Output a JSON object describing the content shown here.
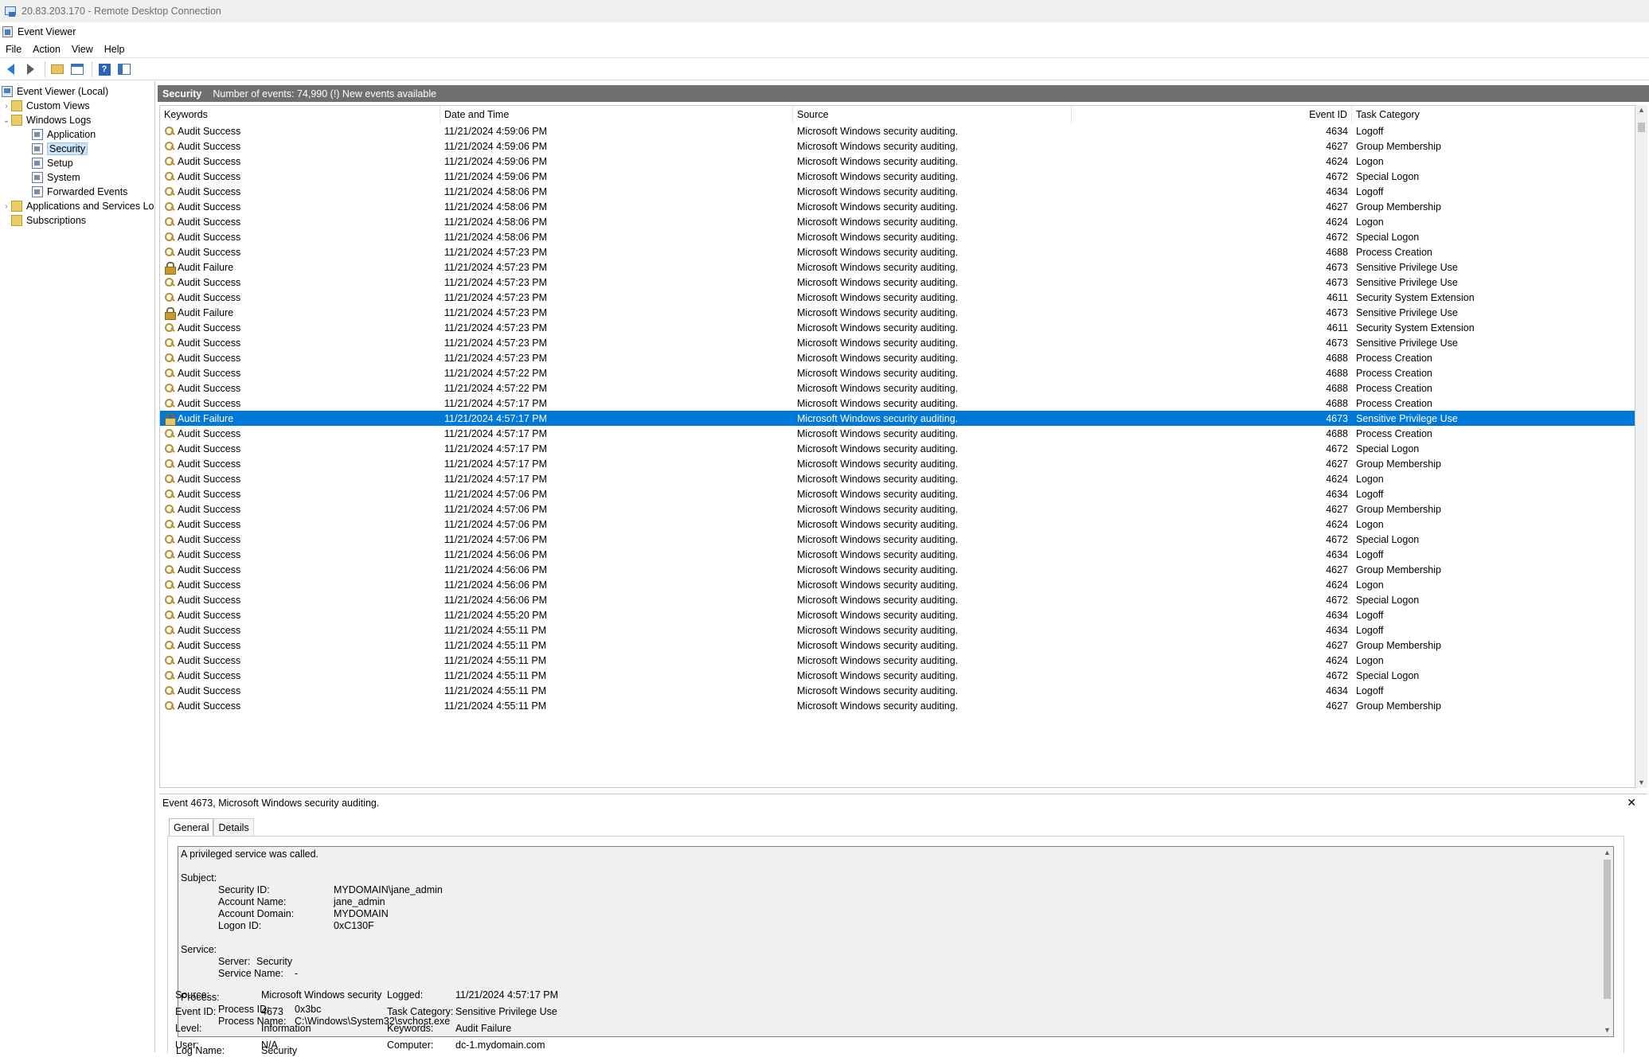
{
  "rdp": {
    "title": "20.83.203.170 - Remote Desktop Connection"
  },
  "app": {
    "title": "Event Viewer"
  },
  "menu": [
    "File",
    "Action",
    "View",
    "Help"
  ],
  "nav": {
    "items": [
      {
        "label": "Event Viewer (Local)",
        "icon": "computer-icon"
      },
      {
        "label": "Custom Views",
        "icon": "folder-icon"
      },
      {
        "label": "Windows Logs",
        "icon": "folder-icon"
      },
      {
        "label": "Application",
        "icon": "log-icon"
      },
      {
        "label": "Security",
        "icon": "log-icon"
      },
      {
        "label": "Setup",
        "icon": "log-icon"
      },
      {
        "label": "System",
        "icon": "log-icon"
      },
      {
        "label": "Forwarded Events",
        "icon": "log-icon"
      },
      {
        "label": "Applications and Services Lo",
        "icon": "folder-icon"
      },
      {
        "label": "Subscriptions",
        "icon": "folder-icon"
      }
    ]
  },
  "log_header": {
    "title": "Security",
    "info": "Number of events: 74,990 (!) New events available"
  },
  "table": {
    "columns": [
      "Keywords",
      "Date and Time",
      "Source",
      "Event ID",
      "Task Category"
    ],
    "rows": [
      [
        "Audit Success",
        "11/21/2024 4:59:06 PM",
        "Microsoft Windows security auditing.",
        "4634",
        "Logoff"
      ],
      [
        "Audit Success",
        "11/21/2024 4:59:06 PM",
        "Microsoft Windows security auditing.",
        "4627",
        "Group Membership"
      ],
      [
        "Audit Success",
        "11/21/2024 4:59:06 PM",
        "Microsoft Windows security auditing.",
        "4624",
        "Logon"
      ],
      [
        "Audit Success",
        "11/21/2024 4:59:06 PM",
        "Microsoft Windows security auditing.",
        "4672",
        "Special Logon"
      ],
      [
        "Audit Success",
        "11/21/2024 4:58:06 PM",
        "Microsoft Windows security auditing.",
        "4634",
        "Logoff"
      ],
      [
        "Audit Success",
        "11/21/2024 4:58:06 PM",
        "Microsoft Windows security auditing.",
        "4627",
        "Group Membership"
      ],
      [
        "Audit Success",
        "11/21/2024 4:58:06 PM",
        "Microsoft Windows security auditing.",
        "4624",
        "Logon"
      ],
      [
        "Audit Success",
        "11/21/2024 4:58:06 PM",
        "Microsoft Windows security auditing.",
        "4672",
        "Special Logon"
      ],
      [
        "Audit Success",
        "11/21/2024 4:57:23 PM",
        "Microsoft Windows security auditing.",
        "4688",
        "Process Creation"
      ],
      [
        "Audit Failure",
        "11/21/2024 4:57:23 PM",
        "Microsoft Windows security auditing.",
        "4673",
        "Sensitive Privilege Use"
      ],
      [
        "Audit Success",
        "11/21/2024 4:57:23 PM",
        "Microsoft Windows security auditing.",
        "4673",
        "Sensitive Privilege Use"
      ],
      [
        "Audit Success",
        "11/21/2024 4:57:23 PM",
        "Microsoft Windows security auditing.",
        "4611",
        "Security System Extension"
      ],
      [
        "Audit Failure",
        "11/21/2024 4:57:23 PM",
        "Microsoft Windows security auditing.",
        "4673",
        "Sensitive Privilege Use"
      ],
      [
        "Audit Success",
        "11/21/2024 4:57:23 PM",
        "Microsoft Windows security auditing.",
        "4611",
        "Security System Extension"
      ],
      [
        "Audit Success",
        "11/21/2024 4:57:23 PM",
        "Microsoft Windows security auditing.",
        "4673",
        "Sensitive Privilege Use"
      ],
      [
        "Audit Success",
        "11/21/2024 4:57:23 PM",
        "Microsoft Windows security auditing.",
        "4688",
        "Process Creation"
      ],
      [
        "Audit Success",
        "11/21/2024 4:57:22 PM",
        "Microsoft Windows security auditing.",
        "4688",
        "Process Creation"
      ],
      [
        "Audit Success",
        "11/21/2024 4:57:22 PM",
        "Microsoft Windows security auditing.",
        "4688",
        "Process Creation"
      ],
      [
        "Audit Success",
        "11/21/2024 4:57:17 PM",
        "Microsoft Windows security auditing.",
        "4688",
        "Process Creation"
      ],
      [
        "Audit Failure",
        "11/21/2024 4:57:17 PM",
        "Microsoft Windows security auditing.",
        "4673",
        "Sensitive Privilege Use"
      ],
      [
        "Audit Success",
        "11/21/2024 4:57:17 PM",
        "Microsoft Windows security auditing.",
        "4688",
        "Process Creation"
      ],
      [
        "Audit Success",
        "11/21/2024 4:57:17 PM",
        "Microsoft Windows security auditing.",
        "4672",
        "Special Logon"
      ],
      [
        "Audit Success",
        "11/21/2024 4:57:17 PM",
        "Microsoft Windows security auditing.",
        "4627",
        "Group Membership"
      ],
      [
        "Audit Success",
        "11/21/2024 4:57:17 PM",
        "Microsoft Windows security auditing.",
        "4624",
        "Logon"
      ],
      [
        "Audit Success",
        "11/21/2024 4:57:06 PM",
        "Microsoft Windows security auditing.",
        "4634",
        "Logoff"
      ],
      [
        "Audit Success",
        "11/21/2024 4:57:06 PM",
        "Microsoft Windows security auditing.",
        "4627",
        "Group Membership"
      ],
      [
        "Audit Success",
        "11/21/2024 4:57:06 PM",
        "Microsoft Windows security auditing.",
        "4624",
        "Logon"
      ],
      [
        "Audit Success",
        "11/21/2024 4:57:06 PM",
        "Microsoft Windows security auditing.",
        "4672",
        "Special Logon"
      ],
      [
        "Audit Success",
        "11/21/2024 4:56:06 PM",
        "Microsoft Windows security auditing.",
        "4634",
        "Logoff"
      ],
      [
        "Audit Success",
        "11/21/2024 4:56:06 PM",
        "Microsoft Windows security auditing.",
        "4627",
        "Group Membership"
      ],
      [
        "Audit Success",
        "11/21/2024 4:56:06 PM",
        "Microsoft Windows security auditing.",
        "4624",
        "Logon"
      ],
      [
        "Audit Success",
        "11/21/2024 4:56:06 PM",
        "Microsoft Windows security auditing.",
        "4672",
        "Special Logon"
      ],
      [
        "Audit Success",
        "11/21/2024 4:55:20 PM",
        "Microsoft Windows security auditing.",
        "4634",
        "Logoff"
      ],
      [
        "Audit Success",
        "11/21/2024 4:55:11 PM",
        "Microsoft Windows security auditing.",
        "4634",
        "Logoff"
      ],
      [
        "Audit Success",
        "11/21/2024 4:55:11 PM",
        "Microsoft Windows security auditing.",
        "4627",
        "Group Membership"
      ],
      [
        "Audit Success",
        "11/21/2024 4:55:11 PM",
        "Microsoft Windows security auditing.",
        "4624",
        "Logon"
      ],
      [
        "Audit Success",
        "11/21/2024 4:55:11 PM",
        "Microsoft Windows security auditing.",
        "4672",
        "Special Logon"
      ],
      [
        "Audit Success",
        "11/21/2024 4:55:11 PM",
        "Microsoft Windows security auditing.",
        "4634",
        "Logoff"
      ],
      [
        "Audit Success",
        "11/21/2024 4:55:11 PM",
        "Microsoft Windows security auditing.",
        "4627",
        "Group Membership"
      ]
    ]
  },
  "detail": {
    "title": "Event 4673, Microsoft Windows security auditing.",
    "tabs": [
      "General",
      "Details"
    ],
    "description": {
      "line1": "A privileged service was called.",
      "subject_label": "Subject:",
      "security_id_label": "Security ID:",
      "security_id": "MYDOMAIN\\jane_admin",
      "account_name_label": "Account Name:",
      "account_name": "jane_admin",
      "account_domain_label": "Account Domain:",
      "account_domain": "MYDOMAIN",
      "logon_id_label": "Logon ID:",
      "logon_id": "0xC130F",
      "service_label": "Service:",
      "server_label": "Server:",
      "server": "Security",
      "service_name_label": "Service Name:",
      "service_name": "-",
      "process_label": "Process:",
      "process_id_label": "Process ID:",
      "process_id": "0x3bc",
      "process_name_label": "Process Name:",
      "process_name": "C:\\Windows\\System32\\svchost.exe"
    },
    "meta": {
      "log_name_label": "Log Name:",
      "log_name": "Security",
      "source_label": "Source:",
      "source": "Microsoft Windows security",
      "logged_label": "Logged:",
      "logged": "11/21/2024 4:57:17 PM",
      "event_id_label": "Event ID:",
      "event_id": "4673",
      "task_category_label": "Task Category:",
      "task_category": "Sensitive Privilege Use",
      "level_label": "Level:",
      "level": "Information",
      "keywords_label": "Keywords:",
      "keywords": "Audit Failure",
      "user_label": "User:",
      "user": "N/A",
      "computer_label": "Computer:",
      "computer": "dc-1.mydomain.com"
    }
  },
  "selected_row_index": 19
}
